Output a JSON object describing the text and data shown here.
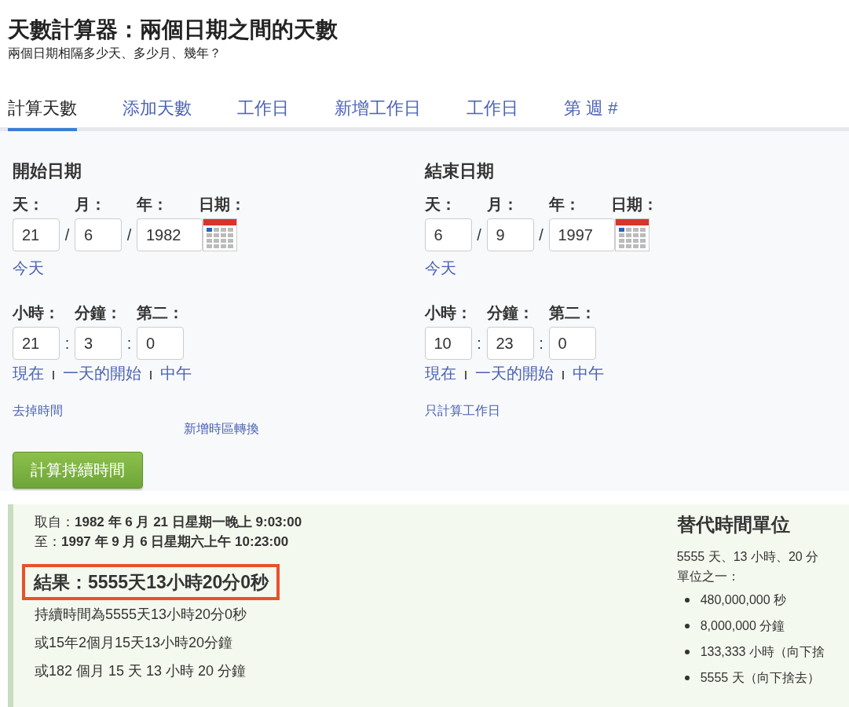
{
  "page": {
    "title": "天數計算器：兩個日期之間的天數",
    "subtitle": "兩個日期相隔多少天、多少月、幾年？"
  },
  "tabs": [
    {
      "label": "計算天數",
      "selected": true
    },
    {
      "label": "添加天數",
      "selected": false
    },
    {
      "label": "工作日",
      "selected": false
    },
    {
      "label": "新增工作日",
      "selected": false
    },
    {
      "label": "工作日",
      "selected": false
    },
    {
      "label": "第 週 #",
      "selected": false
    }
  ],
  "columns": [
    {
      "heading": "開始日期",
      "date_labels": [
        "天：",
        "月：",
        "年：",
        "日期："
      ],
      "date_values": [
        "21",
        "6",
        "1982"
      ],
      "date_separators": [
        "/",
        "/"
      ],
      "today_link": "今天",
      "time_labels": [
        "小時：",
        "分鐘：",
        "第二："
      ],
      "time_values": [
        "21",
        "3",
        "0"
      ],
      "time_separators": [
        ":",
        ":"
      ],
      "time_links": [
        "現在",
        "一天的開始",
        "中午"
      ],
      "extra_links": [
        "去掉時間",
        "新增時區轉換"
      ]
    },
    {
      "heading": "結束日期",
      "date_labels": [
        "天：",
        "月：",
        "年：",
        "日期："
      ],
      "date_values": [
        "6",
        "9",
        "1997"
      ],
      "date_separators": [
        "/",
        "/"
      ],
      "today_link": "今天",
      "time_labels": [
        "小時：",
        "分鐘：",
        "第二："
      ],
      "time_values": [
        "10",
        "23",
        "0"
      ],
      "time_separators": [
        ":",
        ":"
      ],
      "time_links": [
        "現在",
        "一天的開始",
        "中午"
      ],
      "extra_links": [
        "只計算工作日"
      ]
    }
  ],
  "calculate_button": "計算持續時間",
  "result": {
    "from_label": "取自：",
    "from_value": "1982 年 6 月 21 日星期一晚上 9:03:00",
    "to_label": "至：",
    "to_value": "1997 年 9 月 6 日星期六上午 10:23:00",
    "heading": "結果：5555天13小時20分0秒",
    "lines": [
      "持續時間為5555天13小時20分0秒",
      "或15年2個月15天13小時20分鐘",
      "或182 個月 15 天 13 小時 20 分鐘"
    ]
  },
  "alternative_units": {
    "heading": "替代時間單位",
    "intro_lines": [
      "5555 天、13 小時、20 分",
      "單位之一："
    ],
    "items": [
      "480,000,000 秒",
      "8,000,000 分鐘",
      "133,333 小時（向下捨",
      "5555 天（向下捨去）"
    ]
  }
}
